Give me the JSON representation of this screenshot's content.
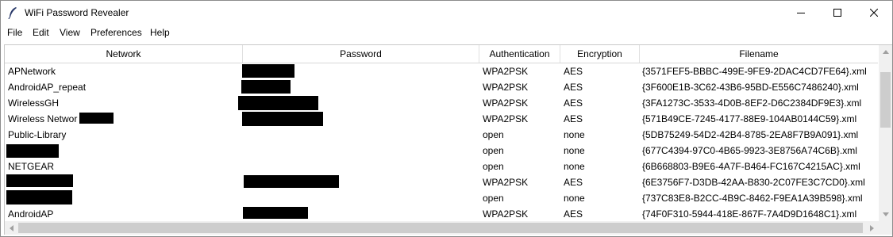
{
  "window": {
    "title": "WiFi Password Revealer",
    "icon": "feather-icon"
  },
  "menu": [
    "File",
    "Edit",
    "View",
    "Preferences",
    "Help"
  ],
  "columns": [
    "Network",
    "Password",
    "Authentication",
    "Encryption",
    "Filename"
  ],
  "rows": [
    {
      "network": "APNetwork",
      "authentication": "WPA2PSK",
      "encryption": "AES",
      "filename": "{3571FEF5-BBBC-499E-9FE9-2DAC4CD7FE64}.xml"
    },
    {
      "network": "AndroidAP_repeat",
      "authentication": "WPA2PSK",
      "encryption": "AES",
      "filename": "{3F600E1B-3C62-43B6-95BD-E556C7486240}.xml"
    },
    {
      "network": "WirelessGH",
      "authentication": "WPA2PSK",
      "encryption": "AES",
      "filename": "{3FA1273C-3533-4D0B-8EF2-D6C2384DF9E3}.xml"
    },
    {
      "network": "Wireless Networ",
      "authentication": "WPA2PSK",
      "encryption": "AES",
      "filename": "{571B49CE-7245-4177-88E9-104AB0144C59}.xml"
    },
    {
      "network": "Public-Library",
      "authentication": "open",
      "encryption": "none",
      "filename": "{5DB75249-54D2-42B4-8785-2EA8F7B9A091}.xml"
    },
    {
      "network": "",
      "authentication": "open",
      "encryption": "none",
      "filename": "{677C4394-97C0-4B65-9923-3E8756A74C6B}.xml"
    },
    {
      "network": "NETGEAR",
      "authentication": "open",
      "encryption": "none",
      "filename": "{6B668803-B9E6-4A7F-B464-FC167C4215AC}.xml"
    },
    {
      "network": "",
      "authentication": "WPA2PSK",
      "encryption": "AES",
      "filename": "{6E3756F7-D3DB-42AA-B830-2C07FE3C7CD0}.xml"
    },
    {
      "network": "",
      "authentication": "open",
      "encryption": "none",
      "filename": "{737C83E8-B2CC-4B9C-8462-F9EA1A39B598}.xml"
    },
    {
      "network": "AndroidAP",
      "authentication": "WPA2PSK",
      "encryption": "AES",
      "filename": "{74F0F310-5944-418E-867F-7A4D9D1648C1}.xml"
    }
  ],
  "colors": {
    "redaction": "#000000",
    "scrollbar_track": "#f0f0f0",
    "scrollbar_thumb": "#cdcdcd"
  }
}
